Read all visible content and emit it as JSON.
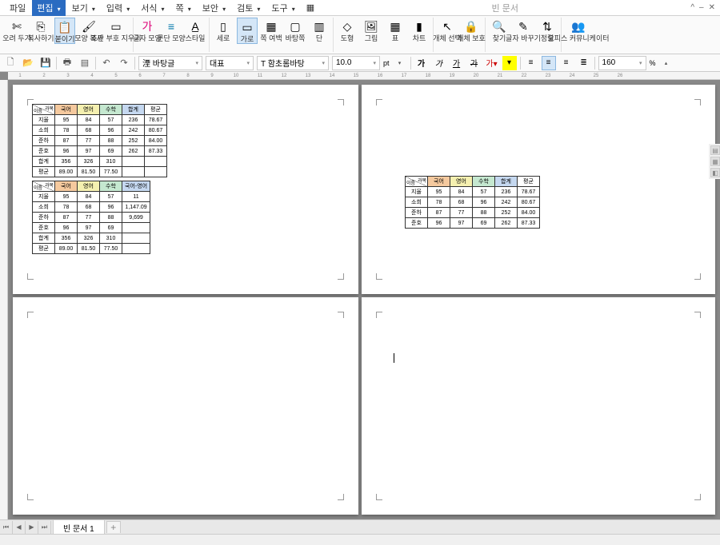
{
  "menu": {
    "file": "파일",
    "edit": "편집",
    "view": "보기",
    "input": "입력",
    "format": "서식",
    "page": "쪽",
    "security": "보안",
    "review": "검토",
    "tools": "도구"
  },
  "title": "빈 문서",
  "ribbon": {
    "cut": "오려\n두기",
    "copy": "복사하기",
    "paste": "붙이기",
    "shapecopy": "모양\n복사",
    "viewmark": "조판 부호\n지우기",
    "charshape": "글자\n모양",
    "parashape": "문단\n모양",
    "style": "스타일",
    "vert": "세로",
    "horiz": "가로",
    "pagem": "쪽\n여백",
    "bg": "바탕쪽",
    "col": "단",
    "shape": "도형",
    "pic": "그림",
    "table": "표",
    "chart": "차트",
    "objsel": "개체\n선택",
    "objprot": "개체\n보호",
    "find": "찾기",
    "replace": "글자\n바꾸기",
    "sort": "정렬",
    "office": "오피스\n커뮤니케이터"
  },
  "formatbar": {
    "style": "바탕글",
    "font": "함초롬바탕",
    "size": "10.0",
    "unit": "pt",
    "zoom": "160",
    "pct": "%"
  },
  "doc": {
    "headers": [
      "과목",
      "국어",
      "영어",
      "수학",
      "합계",
      "평균"
    ],
    "rows1": [
      [
        "지율",
        "95",
        "84",
        "57",
        "236",
        "78.67"
      ],
      [
        "소희",
        "78",
        "68",
        "96",
        "242",
        "80.67"
      ],
      [
        "준하",
        "87",
        "77",
        "88",
        "252",
        "84.00"
      ],
      [
        "준호",
        "96",
        "97",
        "69",
        "262",
        "87.33"
      ],
      [
        "합계",
        "356",
        "326",
        "310",
        "",
        ""
      ],
      [
        "평균",
        "89.00",
        "81.50",
        "77.50",
        "",
        ""
      ]
    ],
    "headers2": [
      "과목",
      "국어",
      "영어",
      "수학",
      "국어-영어"
    ],
    "rows2": [
      [
        "지율",
        "95",
        "84",
        "57",
        "11"
      ],
      [
        "소희",
        "78",
        "68",
        "96",
        "1,147.09"
      ],
      [
        "준하",
        "87",
        "77",
        "88",
        "9,699"
      ],
      [
        "준호",
        "96",
        "97",
        "69",
        ""
      ],
      [
        "합계",
        "356",
        "326",
        "310",
        ""
      ],
      [
        "평균",
        "89.00",
        "81.50",
        "77.50",
        ""
      ]
    ],
    "diag1": "과목",
    "diag2": "이름"
  },
  "tabs": {
    "doc": "빈 문서 1"
  },
  "ruler": [
    "1",
    "2",
    "3",
    "4",
    "5",
    "6",
    "7",
    "8",
    "9",
    "10",
    "11",
    "12",
    "13",
    "14",
    "15",
    "16",
    "17",
    "18",
    "19",
    "20",
    "21",
    "22",
    "23",
    "24",
    "25",
    "26"
  ]
}
